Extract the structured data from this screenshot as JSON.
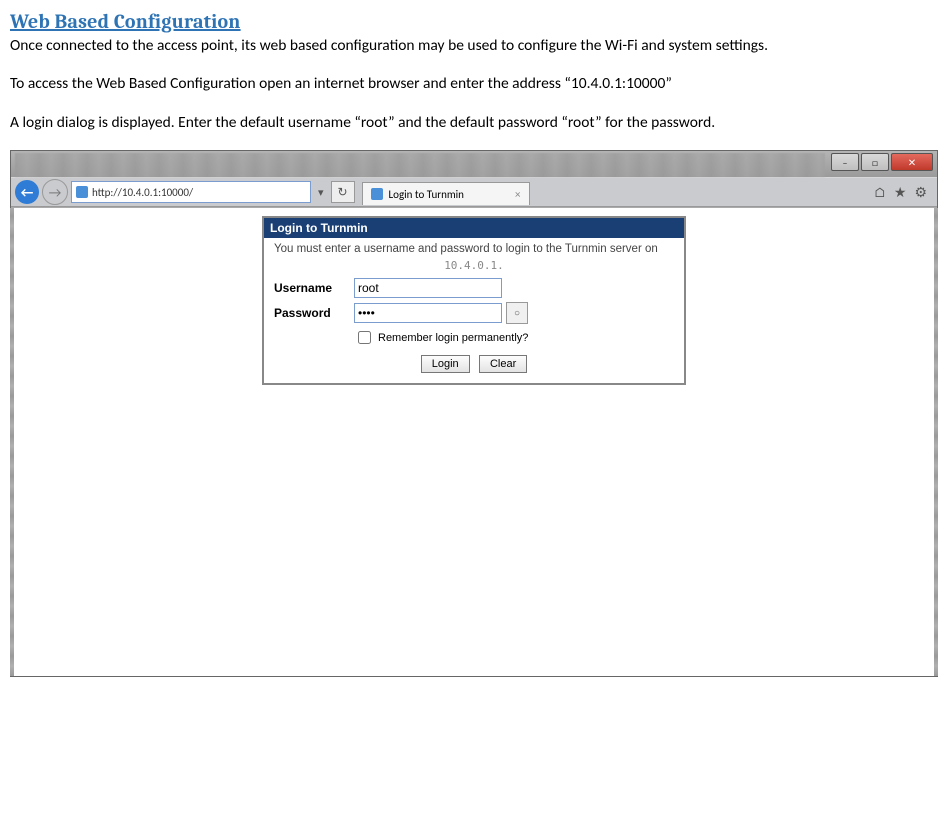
{
  "doc": {
    "title": "Web Based Configuration",
    "p1": "Once connected to the access point, its web based configuration may be used to configure the Wi-Fi and system settings.",
    "p2": "To access the Web Based Configuration open an internet browser and enter the address “10.4.0.1:10000”",
    "p3": "A login dialog is displayed.  Enter the default username “root” and the default password “root” for the password."
  },
  "browser": {
    "url": "http://10.4.0.1:10000/",
    "tab_title": "Login to Turnmin",
    "back_glyph": "←",
    "fwd_glyph": "→",
    "refresh_glyph": "↻",
    "home_glyph": "⌂",
    "star_glyph": "★",
    "gear_glyph": "⚙",
    "min_glyph": "–",
    "max_glyph": "□",
    "close_glyph": "✕",
    "tab_close_glyph": "×"
  },
  "login": {
    "panel_title": "Login to Turnmin",
    "message": "You must enter a username and password to login to the Turnmin server on",
    "host": "10.4.0.1.",
    "username_label": "Username",
    "password_label": "Password",
    "username_value": "root",
    "password_value": "••••",
    "remember_label": "Remember login permanently?",
    "login_btn": "Login",
    "clear_btn": "Clear",
    "eye_glyph": "○"
  }
}
